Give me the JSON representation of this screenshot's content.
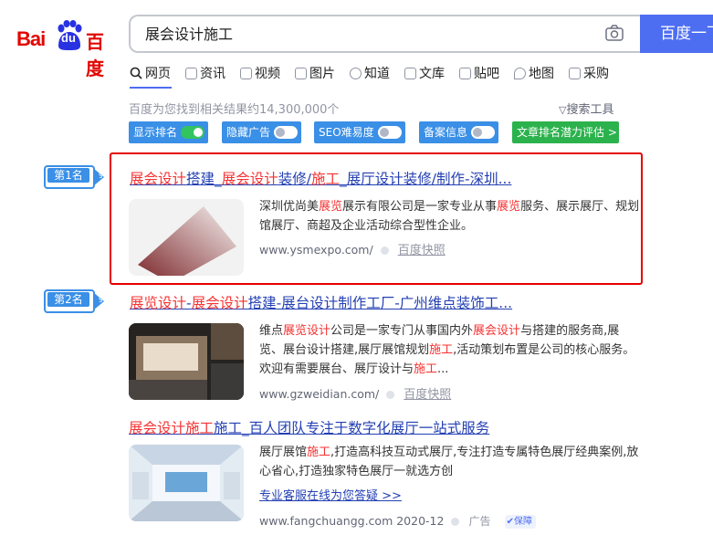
{
  "logo": {
    "latin": "Bai",
    "du": "du",
    "chinese": "百度"
  },
  "search": {
    "query": "展会设计施工",
    "button_label": "百度一下"
  },
  "tabs": [
    {
      "label": "网页",
      "icon": "search-icon"
    },
    {
      "label": "资讯",
      "icon": "news-icon"
    },
    {
      "label": "视频",
      "icon": "video-icon"
    },
    {
      "label": "图片",
      "icon": "image-icon"
    },
    {
      "label": "知道",
      "icon": "question-icon"
    },
    {
      "label": "文库",
      "icon": "doc-icon"
    },
    {
      "label": "贴吧",
      "icon": "tieba-icon"
    },
    {
      "label": "地图",
      "icon": "map-icon"
    },
    {
      "label": "采购",
      "icon": "shop-icon"
    }
  ],
  "result_count": "百度为您找到相关结果约14,300,000个",
  "search_tools": "搜索工具",
  "toggles": [
    {
      "label": "显示排名",
      "on": true
    },
    {
      "label": "隐藏广告",
      "on": false
    },
    {
      "label": "SEO难易度",
      "on": false
    },
    {
      "label": "备案信息",
      "on": false
    }
  ],
  "seo_eval_button": "文章排名潜力评估 >",
  "results": [
    {
      "rank": "第1名",
      "title_parts": [
        {
          "t": "展会设计",
          "hl": true
        },
        {
          "t": "搭建_",
          "hl": false
        },
        {
          "t": "展会设计",
          "hl": true
        },
        {
          "t": "装修/",
          "hl": false
        },
        {
          "t": "施工",
          "hl": true
        },
        {
          "t": "_展厅设计装修/制作-深圳...",
          "hl": false
        }
      ],
      "desc_parts": [
        {
          "t": "深圳优尚美",
          "hl": false
        },
        {
          "t": "展览",
          "hl": true
        },
        {
          "t": "展示有限公司是一家专业从事",
          "hl": false
        },
        {
          "t": "展览",
          "hl": true
        },
        {
          "t": "服务、展示展厅、规划馆展厅、商超及企业活动综合型性企业。",
          "hl": false
        }
      ],
      "url": "www.ysmexpo.com/",
      "snapshot": "百度快照"
    },
    {
      "rank": "第2名",
      "title_parts": [
        {
          "t": "展览设计",
          "hl": true
        },
        {
          "t": "-",
          "hl": false
        },
        {
          "t": "展会设计",
          "hl": true
        },
        {
          "t": "搭建-展台设计制作工厂-广州维点装饰工...",
          "hl": false
        }
      ],
      "desc_parts": [
        {
          "t": "维点",
          "hl": false
        },
        {
          "t": "展览设计",
          "hl": true
        },
        {
          "t": "公司是一家专门从事国内外",
          "hl": false
        },
        {
          "t": "展会设计",
          "hl": true
        },
        {
          "t": "与搭建的服务商,展览、展台设计搭建,展厅展馆规划",
          "hl": false
        },
        {
          "t": "施工",
          "hl": true
        },
        {
          "t": ",活动策划布置是公司的核心服务。欢迎有需要展台、展厅设计与",
          "hl": false
        },
        {
          "t": "施工",
          "hl": true
        },
        {
          "t": "...",
          "hl": false
        }
      ],
      "url": "www.gzweidian.com/",
      "snapshot": "百度快照"
    },
    {
      "title_parts": [
        {
          "t": "展会设计施工",
          "hl": true
        },
        {
          "t": "施工_百人团队专注于数字化展厅一站式服务",
          "hl": false
        }
      ],
      "desc_parts": [
        {
          "t": "展厅展馆",
          "hl": false
        },
        {
          "t": "施工",
          "hl": true
        },
        {
          "t": ",打造高科技互动式展厅,专注打造专属特色展厅经典案例,放心省心,打造独家特色展厅一就选方创",
          "hl": false
        }
      ],
      "service_link": "专业客服在线为您答疑 >>",
      "url": "www.fangchuangg.com 2020-12",
      "ad_label": "广告",
      "protect_label": "保障"
    }
  ]
}
